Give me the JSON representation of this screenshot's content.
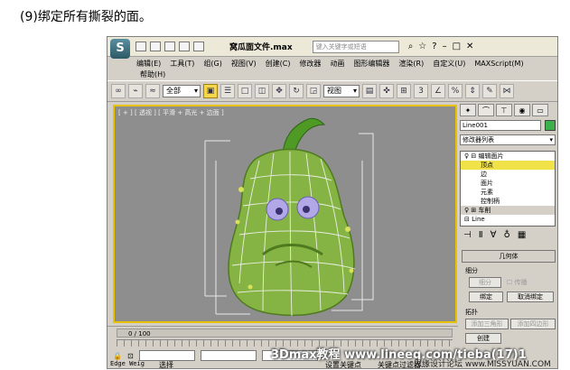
{
  "caption": "(9)绑定所有撕裂的面。",
  "window": {
    "title": "窝瓜面文件.max",
    "search_placeholder": "键入关键字或短语",
    "menus": [
      "编辑(E)",
      "工具(T)",
      "组(G)",
      "视图(V)",
      "创建(C)",
      "修改器",
      "动画",
      "图形编辑器",
      "渲染(R)",
      "自定义(U)",
      "MAXScript(M)"
    ],
    "menu_help": "帮助(H)"
  },
  "toolbar": {
    "filter_value": "全部",
    "view_value": "视图"
  },
  "viewport": {
    "label": "[ + ] [ 透视 ] [ 平滑 + 高光 + 边面 ]"
  },
  "command_panel": {
    "object_name": "Line001",
    "modifier_list": "修改器列表",
    "stack": [
      {
        "label": "编辑面片",
        "selected": false,
        "indent": false
      },
      {
        "label": "顶点",
        "selected": true,
        "indent": true
      },
      {
        "label": "边",
        "selected": false,
        "indent": true
      },
      {
        "label": "面片",
        "selected": false,
        "indent": true
      },
      {
        "label": "元素",
        "selected": false,
        "indent": true
      },
      {
        "label": "控制柄",
        "selected": false,
        "indent": true
      },
      {
        "label": "车削",
        "selected": false,
        "indent": false
      },
      {
        "label": "Line",
        "selected": false,
        "indent": false
      }
    ],
    "rollout_title": "几何体",
    "group_subdivide": "细分",
    "btn_subdivide": "细分",
    "chk_propagate": "传播",
    "btn_bind": "绑定",
    "btn_unbind": "取消绑定",
    "group_topology": "拓扑",
    "btn_add_tri": "添加三角形",
    "btn_add_quad": "添加四边形",
    "btn_create": "创建"
  },
  "status": {
    "time_slider": "0 / 100",
    "edge_label": "Edge Weig",
    "select_label": "选择",
    "set_key": "设置关键点",
    "key_filter": "关键点过滤器..."
  },
  "watermark": {
    "main": "3Dmax教程 www.lineeq.com/tieba(17)1",
    "sub": "思缘设计论坛 www.MISSYUAN.COM"
  }
}
